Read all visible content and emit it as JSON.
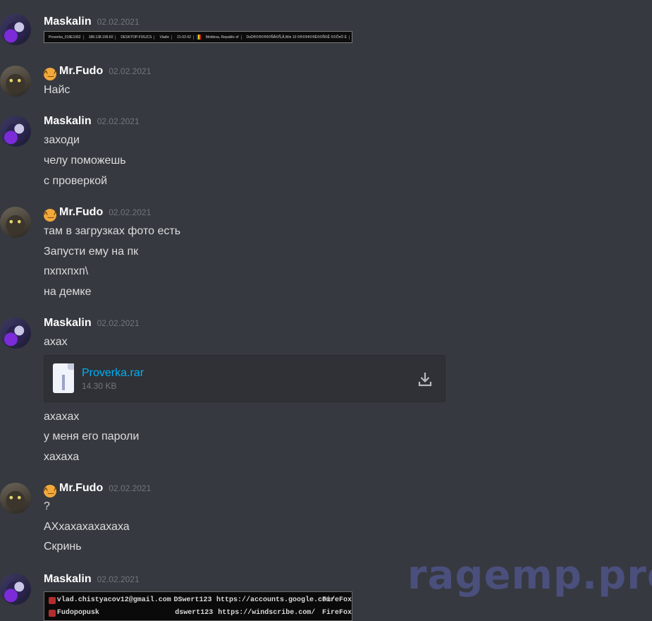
{
  "messages": [
    {
      "author": "Maskalin",
      "timestamp": "02.02.2021"
    },
    {
      "author": "Mr.Fudo",
      "timestamp": "02.02.2021",
      "lines": [
        "Найс"
      ]
    },
    {
      "author": "Maskalin",
      "timestamp": "02.02.2021",
      "lines": [
        "заходи",
        "челу поможешь",
        "с проверкой"
      ]
    },
    {
      "author": "Mr.Fudo",
      "timestamp": "02.02.2021",
      "lines": [
        "там в загрузках фото есть",
        "Запусти ему на пк",
        "пхпхпхп\\",
        "на демке"
      ]
    },
    {
      "author": "Maskalin",
      "timestamp": "02.02.2021",
      "lines": [
        "ахах",
        "ахахах",
        "у меня его пароли",
        "хахаха"
      ]
    },
    {
      "author": "Mr.Fudo",
      "timestamp": "02.02.2021",
      "lines": [
        "?",
        "АХхахахахахаха",
        "Скринь"
      ]
    },
    {
      "author": "Maskalin",
      "timestamp": "02.02.2021"
    }
  ],
  "image1": {
    "cells": [
      "Proverka_019E1062",
      "188.138.199.60",
      "DESKTOP-F9SJCS",
      "Vladic",
      "21-02-02",
      "Moldova, Republic of",
      "DoD®©®©®¢©ÑÂ©Ñ,Â,Win 10 ©®©®¢©®È©©Ñ©Ê ©©Ô¤Ò È"
    ]
  },
  "attachment": {
    "name": "Proverka.rar",
    "size": "14.30 KB"
  },
  "image2": {
    "rows": [
      {
        "login": "vlad.chistyacov12@gmail.com",
        "password": "DSwert123",
        "url": "https://accounts.google.com/",
        "browser": "FireFox"
      },
      {
        "login": "Fudopopusk",
        "password": "dswert123",
        "url": "https://windscribe.com/",
        "browser": "FireFox"
      }
    ]
  },
  "watermark": "ragemp.pro",
  "icons": {
    "emoji": "cat-emoji-icon",
    "download": "download-icon",
    "file": "archive-file-icon"
  }
}
